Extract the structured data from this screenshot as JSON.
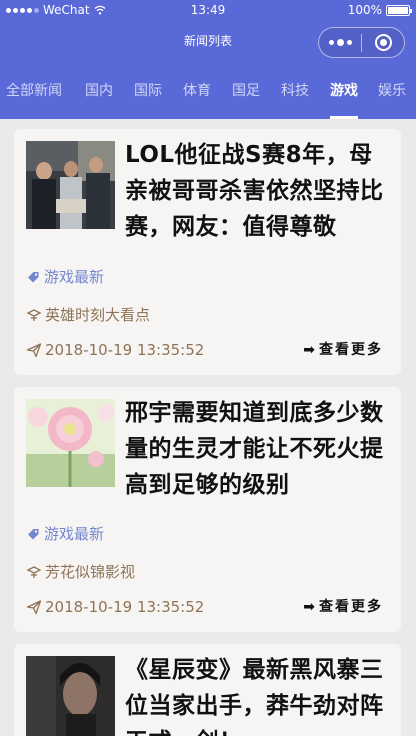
{
  "status_bar": {
    "carrier": "WeChat",
    "time": "13:49",
    "battery": "100%"
  },
  "nav": {
    "title": "新闻列表"
  },
  "tabs": [
    {
      "label": "全部新闻"
    },
    {
      "label": "国内"
    },
    {
      "label": "国际"
    },
    {
      "label": "体育"
    },
    {
      "label": "国足"
    },
    {
      "label": "科技"
    },
    {
      "label": "游戏",
      "active": true
    },
    {
      "label": "娱乐"
    }
  ],
  "articles": [
    {
      "title": "LOL他征战S赛8年，母亲被哥哥杀害依然坚持比赛，网友：值得尊敬",
      "category": "游戏最新",
      "source": "英雄时刻大看点",
      "time": "2018-10-19 13:35:52",
      "more": "查看更多"
    },
    {
      "title": "邢宇需要知道到底多少数量的生灵才能让不死火提高到足够的级别",
      "category": "游戏最新",
      "source": "芳花似锦影视",
      "time": "2018-10-19 13:35:52",
      "more": "查看更多"
    },
    {
      "title": "《星辰变》最新黑风寨三位当家出手，莽牛劲对阵天式一剑！",
      "category": "",
      "source": "",
      "time": "",
      "more": ""
    }
  ],
  "icons": {
    "category": "tag-icon",
    "source": "author-icon",
    "time": "send-icon",
    "more": "arrow-right-icon"
  },
  "colors": {
    "header_bg": "#5969d8",
    "page_bg": "#ece9ea",
    "card_bg": "#f7f5f4",
    "category_text": "#7386cf",
    "meta_text": "#8e7356"
  }
}
